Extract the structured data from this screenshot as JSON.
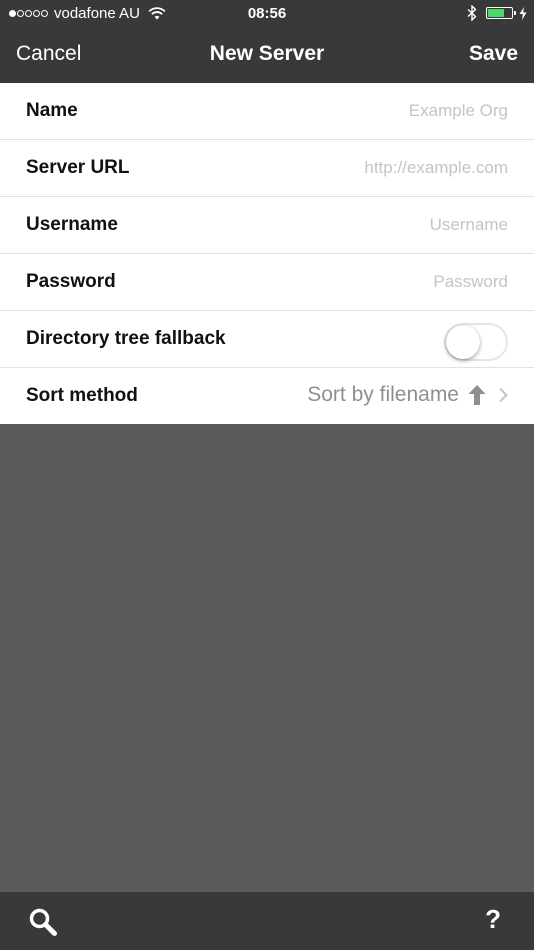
{
  "status_bar": {
    "carrier": "vodafone AU",
    "time": "08:56",
    "signal_bars_filled": 1,
    "signal_bars_total": 5,
    "battery_level": 0.7,
    "battery_color": "#4cd964"
  },
  "nav": {
    "cancel_label": "Cancel",
    "title": "New Server",
    "save_label": "Save"
  },
  "form": {
    "name": {
      "label": "Name",
      "placeholder": "Example Org",
      "value": ""
    },
    "server_url": {
      "label": "Server URL",
      "placeholder": "http://example.com",
      "value": ""
    },
    "username": {
      "label": "Username",
      "placeholder": "Username",
      "value": ""
    },
    "password": {
      "label": "Password",
      "placeholder": "Password",
      "value": ""
    },
    "directory_fallback": {
      "label": "Directory tree fallback",
      "enabled": false
    },
    "sort_method": {
      "label": "Sort method",
      "value": "Sort by filename",
      "direction_icon": "arrow-up-icon"
    }
  },
  "toolbar": {
    "search_icon": "search-icon",
    "help_label": "?"
  },
  "colors": {
    "bar_background": "#393939",
    "content_background": "#5a5a5a",
    "form_background": "#ffffff",
    "placeholder": "#c4c4c8",
    "secondary_text": "#8e8e93"
  }
}
